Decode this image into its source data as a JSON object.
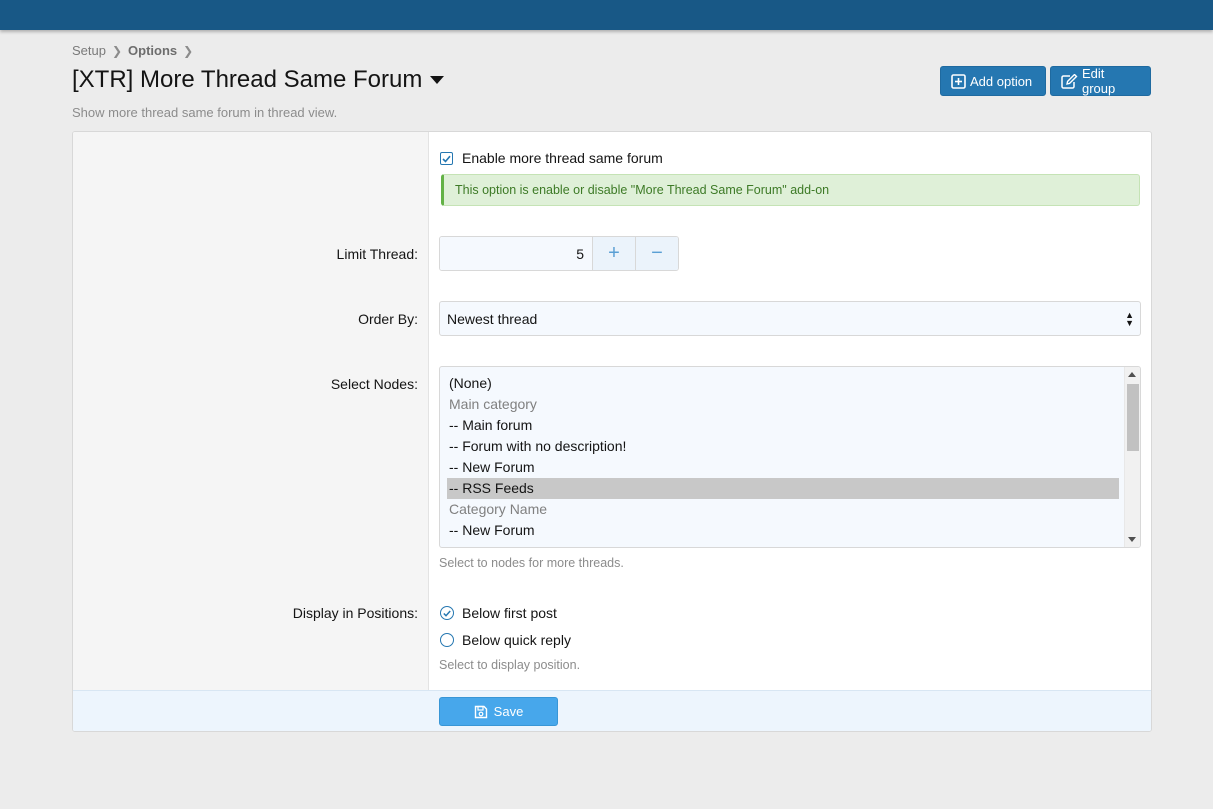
{
  "colors": {
    "header_bar": "#185886",
    "accent": "#2577b1",
    "save": "#47a7eb",
    "success_bg": "#dff0d8"
  },
  "breadcrumb": {
    "items": [
      "Setup",
      "Options"
    ]
  },
  "page": {
    "title": "[XTR] More Thread Same Forum",
    "description": "Show more thread same forum in thread view."
  },
  "header_buttons": {
    "add_option": "Add option",
    "edit_group": "Edit group"
  },
  "form": {
    "enable": {
      "label": "Enable more thread same forum",
      "checked": true,
      "explain": "This option is enable or disable \"More Thread Same Forum\" add-on"
    },
    "limit_thread": {
      "label": "Limit Thread:",
      "value": "5",
      "plus": "+",
      "minus": "−"
    },
    "order_by": {
      "label": "Order By:",
      "selected": "Newest thread"
    },
    "select_nodes": {
      "label": "Select Nodes:",
      "items": [
        {
          "text": "(None)",
          "state": "normal"
        },
        {
          "text": "Main category",
          "state": "disabled"
        },
        {
          "text": "-- Main forum",
          "state": "normal"
        },
        {
          "text": "-- Forum with no description!",
          "state": "normal"
        },
        {
          "text": "-- New Forum",
          "state": "normal"
        },
        {
          "text": "-- RSS Feeds",
          "state": "selected"
        },
        {
          "text": "Category Name",
          "state": "disabled"
        },
        {
          "text": "-- New Forum",
          "state": "normal"
        }
      ],
      "hint": "Select to nodes for more threads."
    },
    "display_positions": {
      "label": "Display in Positions:",
      "options": [
        {
          "text": "Below first post",
          "selected": true
        },
        {
          "text": "Below quick reply",
          "selected": false
        }
      ],
      "hint": "Select to display position."
    }
  },
  "footer": {
    "save_label": "Save"
  }
}
